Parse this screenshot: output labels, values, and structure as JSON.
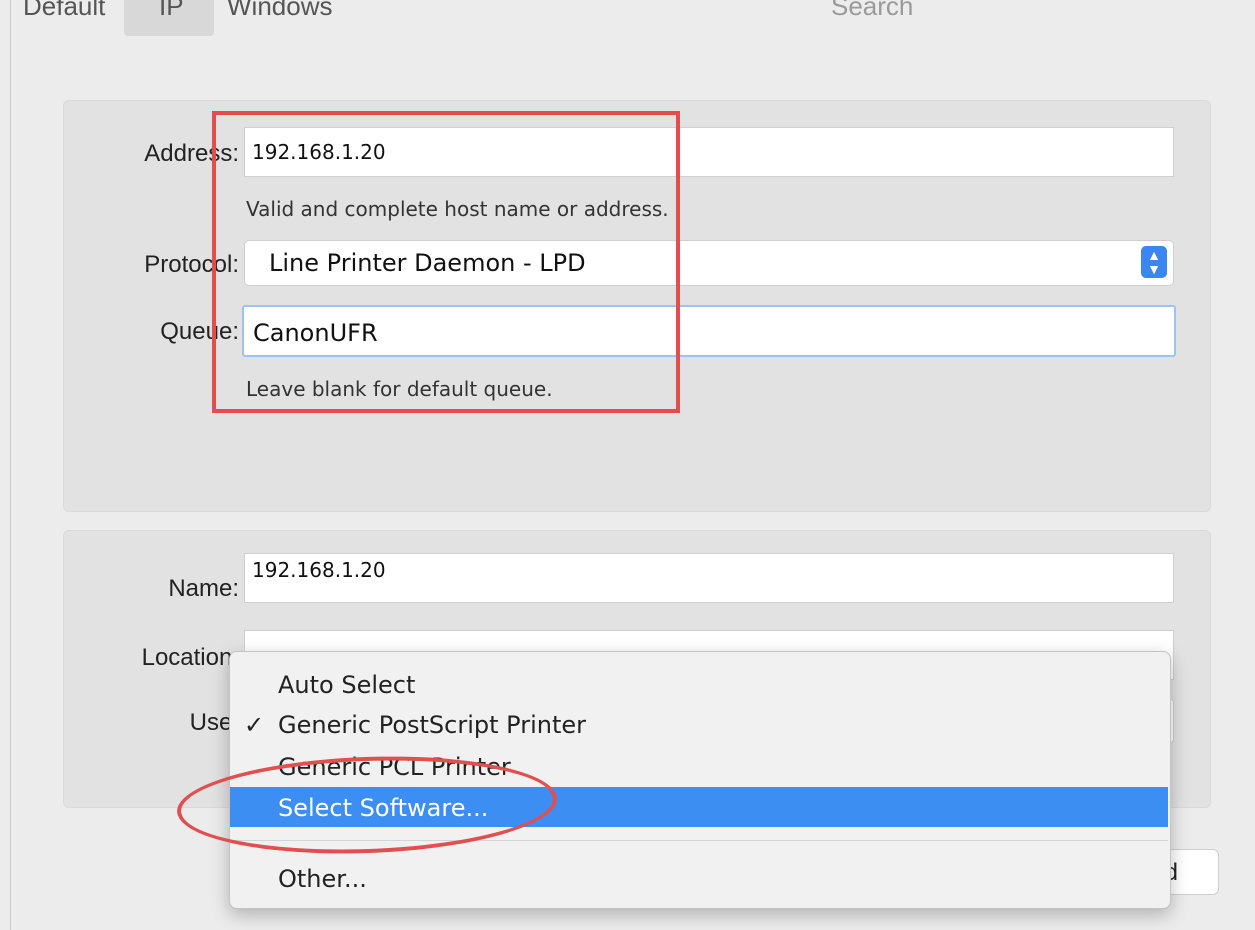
{
  "toolbar": {
    "tabs": [
      "Default",
      "IP",
      "Windows"
    ],
    "search_label": "Search"
  },
  "connection": {
    "address_label": "Address:",
    "address_value": "192.168.1.20",
    "address_hint": "Valid and complete host name or address.",
    "protocol_label": "Protocol:",
    "protocol_value": "Line Printer Daemon - LPD",
    "queue_label": "Queue:",
    "queue_value": "CanonUFR",
    "queue_hint": "Leave blank for default queue."
  },
  "printer": {
    "name_label": "Name:",
    "name_value": "192.168.1.20",
    "location_label": "Location:",
    "location_value": "",
    "use_label": "Use:"
  },
  "use_menu": {
    "items": [
      "Auto Select",
      "Generic PostScript Printer",
      "Generic PCL Printer",
      "Select Software...",
      "Other..."
    ],
    "checked_item": "Generic PostScript Printer",
    "check_mark": "✓",
    "highlighted_item": "Select Software..."
  },
  "add_button_partial": "d",
  "colors": {
    "accent": "#3c8ef3",
    "annotation_red": "#e74c4c",
    "window_bg": "#ececec"
  }
}
